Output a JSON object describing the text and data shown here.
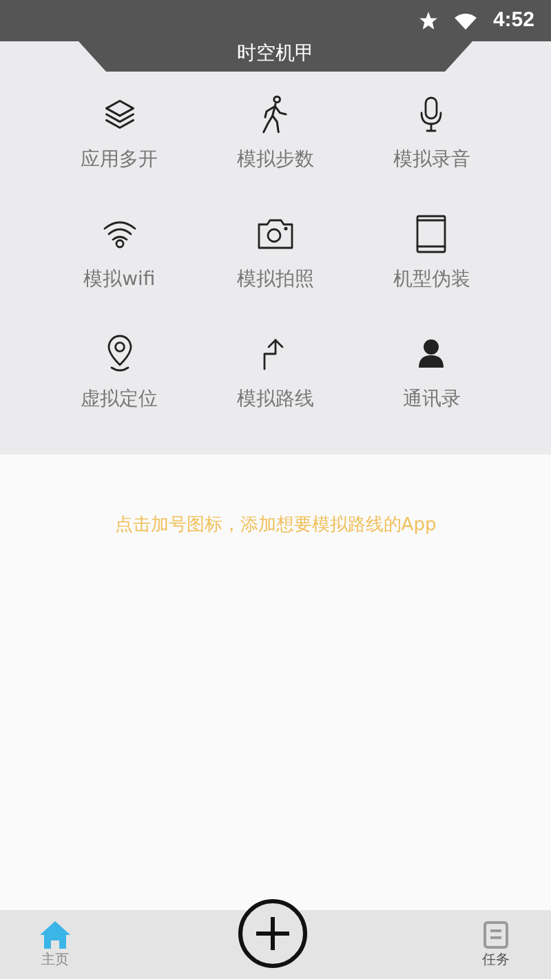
{
  "status_bar": {
    "time": "4:52"
  },
  "header": {
    "title": "时空机甲"
  },
  "features": [
    {
      "label": "应用多开",
      "kind": "layers"
    },
    {
      "label": "模拟步数",
      "kind": "walk"
    },
    {
      "label": "模拟录音",
      "kind": "mic"
    },
    {
      "label": "模拟wifi",
      "kind": "wifi"
    },
    {
      "label": "模拟拍照",
      "kind": "camera"
    },
    {
      "label": "机型伪装",
      "kind": "phone"
    },
    {
      "label": "虚拟定位",
      "kind": "pin"
    },
    {
      "label": "模拟路线",
      "kind": "route"
    },
    {
      "label": "通讯录",
      "kind": "contact"
    }
  ],
  "hint": "点击加号图标，添加想要模拟路线的App",
  "bottom_nav": [
    {
      "label": "主页",
      "kind": "home",
      "selected": true
    },
    {
      "label": "任务",
      "kind": "task",
      "selected": false
    }
  ]
}
